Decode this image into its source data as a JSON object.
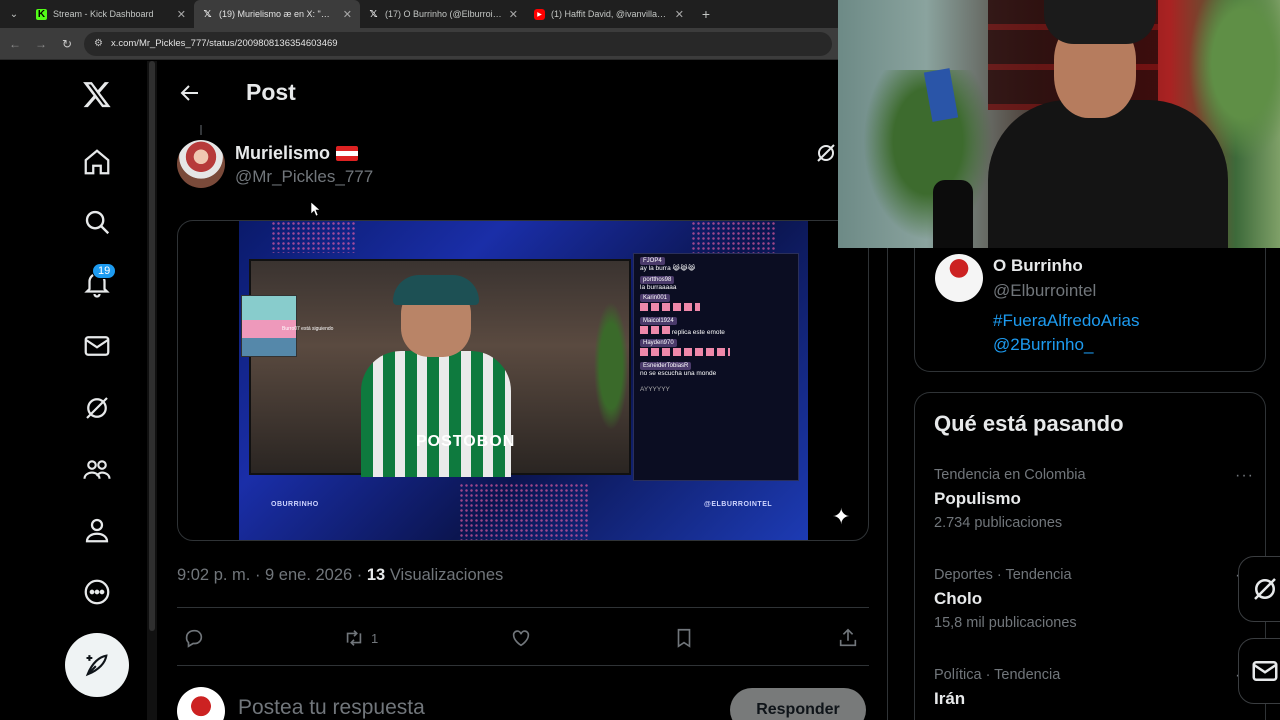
{
  "browser": {
    "tabs": [
      {
        "label": "Stream - Kick Dashboard",
        "favicon": "K",
        "favicon_kind": "kick",
        "active": false
      },
      {
        "label": "(19) Murielismo æ en X: \"@Elbu",
        "favicon": "𝕏",
        "favicon_kind": "x",
        "active": true
      },
      {
        "label": "(17) O Burrinho (@Elburrointel)",
        "favicon": "𝕏",
        "favicon_kind": "x",
        "active": false
      },
      {
        "label": "(1) Haffit David, @ivanvillazon",
        "favicon": "▶",
        "favicon_kind": "youtube",
        "active": false
      }
    ],
    "url": "x.com/Mr_Pickles_777/status/2009808136354603469"
  },
  "nav": {
    "notifications_badge": "19"
  },
  "post": {
    "header_title": "Post",
    "author_name": "Murielismo",
    "author_handle": "@Mr_Pickles_777",
    "timestamp": "9:02 p. m. · 9 ene. 2026 · ",
    "views_count": "13",
    "views_label": " Visualizaciones",
    "retweet_count": "1",
    "media": {
      "shirt_text": "POSTOBON",
      "inset_text": "Burro07 está siguiendo",
      "watermark_left": "OBURRINHO",
      "watermark_right": "@ELBURROINTEL",
      "chat": [
        {
          "user": "FJOP4",
          "msg": "ay la burra 😹😹😹"
        },
        {
          "user": "portthos98",
          "msg": "la burraaaaa"
        },
        {
          "user": "Karin001",
          "msg": ""
        },
        {
          "user": "Maicol1924",
          "msg": "replica este emote"
        },
        {
          "user": "Hayden970",
          "msg": ""
        },
        {
          "user": "EsneiderTobiasR",
          "msg": "no se escucha una monde"
        },
        {
          "user": "",
          "msg": "AYYYYYY"
        }
      ]
    },
    "reply_placeholder": "Postea tu respuesta",
    "reply_button": "Responder"
  },
  "profile_card": {
    "name": "O Burrinho",
    "handle": "@Elburrointel",
    "link1": "#FueraAlfredoArias",
    "link2": "@2Burrinho_"
  },
  "trends": {
    "title": "Qué está pasando",
    "items": [
      {
        "context": "Tendencia en Colombia",
        "name": "Populismo",
        "count": "2.734 publicaciones"
      },
      {
        "context": "Deportes · Tendencia",
        "name": "Cholo",
        "count": "15,8 mil publicaciones"
      },
      {
        "context": "Política · Tendencia",
        "name": "Irán",
        "count": ""
      }
    ],
    "more_glyph": "···"
  },
  "colors": {
    "accent": "#1d9bf0",
    "background": "#000000",
    "text_primary": "#e7e9ea",
    "text_secondary": "#71767b",
    "border": "#2f3336"
  },
  "icons": [
    "x-logo-icon",
    "home-icon",
    "search-icon",
    "notifications-icon",
    "messages-icon",
    "grok-icon",
    "communities-icon",
    "profile-icon",
    "more-icon",
    "compose-icon",
    "back-arrow-icon",
    "reply-icon",
    "retweet-icon",
    "like-icon",
    "bookmark-icon",
    "share-icon",
    "sparkle-icon"
  ]
}
